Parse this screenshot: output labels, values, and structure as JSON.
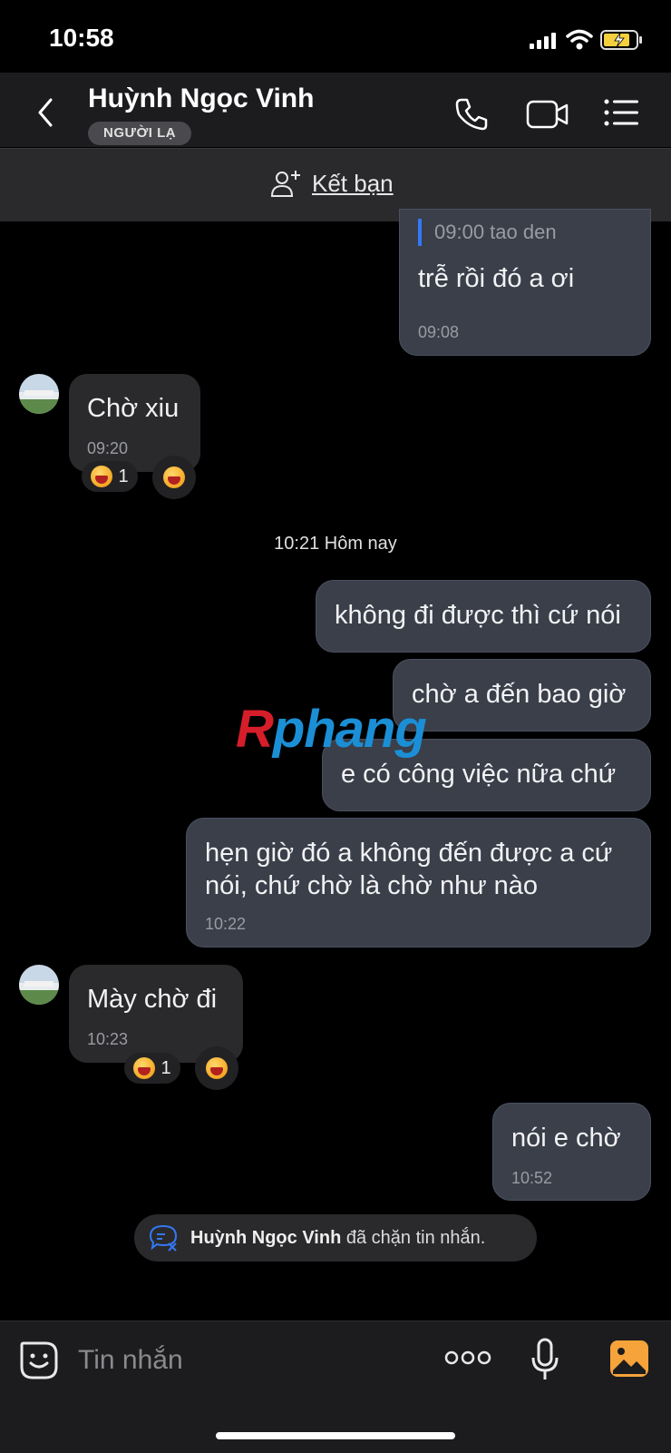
{
  "status_bar": {
    "time": "10:58"
  },
  "header": {
    "contact_name": "Huỳnh Ngọc Vinh",
    "badge": "NGƯỜI LẠ",
    "icons": [
      "back-chevron-icon",
      "phone-icon",
      "video-camera-icon",
      "menu-list-icon"
    ]
  },
  "friend_bar": {
    "label": "Kết bạn",
    "icon": "add-person-icon"
  },
  "messages": [
    {
      "side": "out",
      "quote": "09:00 tao den",
      "text": "trễ rồi đó a ơi",
      "time": "09:08"
    },
    {
      "side": "in",
      "text": "Chờ xiu",
      "time": "09:20",
      "reaction_count": "1"
    },
    {
      "side": "out",
      "text": "không đi được thì cứ nói"
    },
    {
      "side": "out",
      "text": "chờ a đến bao giờ"
    },
    {
      "side": "out",
      "text": "e có công việc nữa chứ"
    },
    {
      "side": "out",
      "text_line1": "hẹn giờ đó a không đến được a cứ",
      "text_line2": "nói, chứ chờ là chờ như nào",
      "time": "10:22"
    },
    {
      "side": "in",
      "text": "Mày chờ đi",
      "time": "10:23",
      "reaction_count": "1"
    },
    {
      "side": "out",
      "text": "nói e chờ",
      "time": "10:52"
    }
  ],
  "date_divider": "10:21 Hôm nay",
  "blocked_notice": {
    "name": "Huỳnh Ngọc Vinh",
    "text": " đã chặn tin nhắn."
  },
  "watermark": "Rphang",
  "input_bar": {
    "placeholder": "Tin nhắn"
  },
  "colors": {
    "outgoing_bubble": "#3a3f4a",
    "incoming_bubble": "#2a2a2c",
    "quote_bar": "#3478f6",
    "gallery_icon": "#f5a33a"
  }
}
